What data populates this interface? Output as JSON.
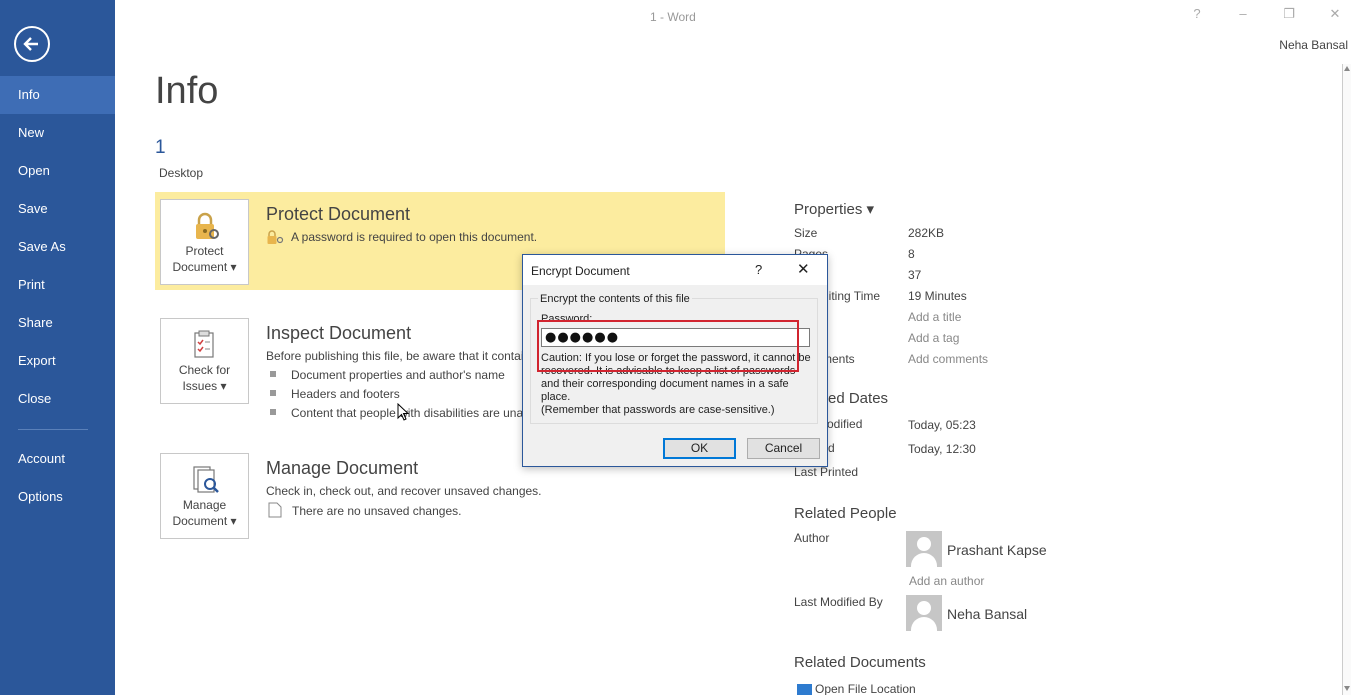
{
  "window": {
    "title": "1 - Word",
    "user": "Neha Bansal",
    "controls": {
      "help": "?",
      "minimize": "–",
      "restore": "❐",
      "close": "✕"
    }
  },
  "sidebar": {
    "back_icon": "back-arrow-icon",
    "items": [
      {
        "label": "Info",
        "active": true
      },
      {
        "label": "New"
      },
      {
        "label": "Open"
      },
      {
        "label": "Save"
      },
      {
        "label": "Save As"
      },
      {
        "label": "Print"
      },
      {
        "label": "Share"
      },
      {
        "label": "Export"
      },
      {
        "label": "Close"
      },
      {
        "label": "Account"
      },
      {
        "label": "Options"
      }
    ],
    "background": "#2b579a",
    "active_background": "#3e6db5"
  },
  "main": {
    "title": "Info",
    "doc_name": "1",
    "doc_location": "Desktop",
    "protect": {
      "tile_line1": "Protect",
      "tile_line2": "Document ▾",
      "title": "Protect Document",
      "text": "A password is required to open this document.",
      "highlight_color": "#fcec9f"
    },
    "inspect": {
      "tile_line1": "Check for",
      "tile_line2": "Issues ▾",
      "title": "Inspect Document",
      "text": "Before publishing this file, be aware that it contai",
      "bullets": [
        "Document properties and author's name",
        "Headers and footers",
        "Content that people with disabilities are una"
      ]
    },
    "manage": {
      "tile_line1": "Manage",
      "tile_line2": "Document ▾",
      "title": "Manage Document",
      "text": "Check in, check out, and recover unsaved changes.",
      "status": "There are no unsaved changes."
    }
  },
  "properties": {
    "heading": "Properties ▾",
    "rows": [
      {
        "label": "Size",
        "value": "282KB"
      },
      {
        "label": "Pages",
        "value": "8"
      },
      {
        "label": "",
        "value": "37"
      },
      {
        "label": "diting Time",
        "value": "19 Minutes"
      },
      {
        "label": "",
        "value": "Add a title"
      },
      {
        "label": "",
        "value": "Add a tag"
      },
      {
        "label": "ments",
        "value": "Add comments"
      }
    ],
    "dates_heading": "ed Dates",
    "dates": [
      {
        "label": "odified",
        "value": "Today, 05:23"
      },
      {
        "label": "d",
        "value": "Today, 12:30"
      },
      {
        "label": "Last Printed",
        "value": ""
      }
    ],
    "people_heading": "Related People",
    "author_label": "Author",
    "author_name": "Prashant Kapse",
    "add_author": "Add an author",
    "last_modified_label": "Last Modified By",
    "last_modified_name": "Neha Bansal",
    "documents_heading": "Related Documents",
    "open_location": "Open File Location"
  },
  "dialog": {
    "title": "Encrypt Document",
    "help": "?",
    "close": "✕",
    "group_label": "Encrypt the contents of this file",
    "password_label": "Password:",
    "password_value": "●●●●●●",
    "caution": "Caution: If you lose or forget the password, it cannot be recovered. It is advisable to keep a list of passwords and their corresponding document names in a safe place.",
    "caution_note": "(Remember that passwords are case-sensitive.)",
    "ok": "OK",
    "cancel": "Cancel",
    "highlight_color": "#d1242f"
  }
}
